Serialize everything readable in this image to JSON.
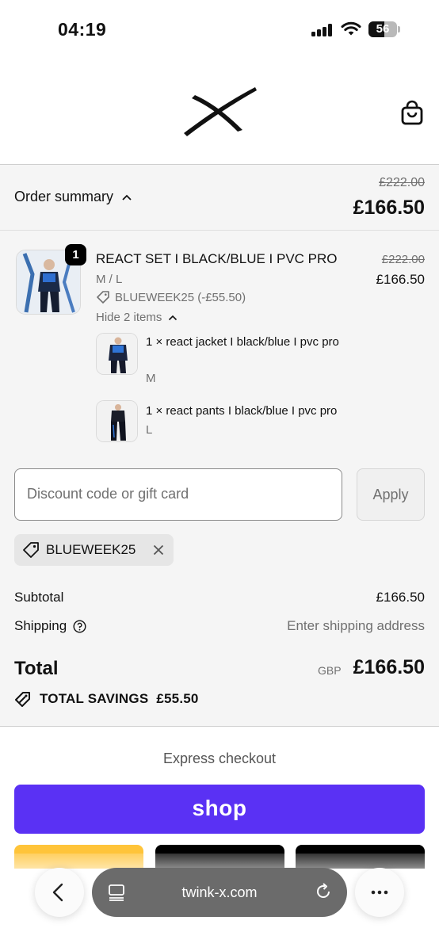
{
  "status_bar": {
    "time": "04:19",
    "battery": "56",
    "battery_level_percent": 56
  },
  "header": {
    "logo_icon": "x-logo",
    "cart_icon": "shopping-bag-icon"
  },
  "summary": {
    "toggle_label": "Order summary",
    "original_price": "£222.00",
    "price": "£166.50"
  },
  "product": {
    "quantity_badge": "1",
    "title": "REACT SET I BLACK/BLUE I PVC PRO",
    "variant": "M / L",
    "discount": "BLUEWEEK25 (-£55.50)",
    "original_price": "£222.00",
    "price": "£166.50",
    "hide_items_label": "Hide 2 items",
    "items": [
      {
        "name": "1 × react jacket I black/blue I pvc pro",
        "size": "M"
      },
      {
        "name": "1 × react pants I black/blue I pvc pro",
        "size": "L"
      }
    ]
  },
  "discount_form": {
    "placeholder": "Discount code or gift card",
    "apply_label": "Apply",
    "applied_code": "BLUEWEEK25"
  },
  "totals": {
    "subtotal_label": "Subtotal",
    "subtotal_value": "£166.50",
    "shipping_label": "Shipping",
    "shipping_value": "Enter shipping address",
    "total_label": "Total",
    "currency": "GBP",
    "total_value": "£166.50",
    "savings_label": "TOTAL SAVINGS",
    "savings_value": "£55.50"
  },
  "express": {
    "label": "Express checkout",
    "shop_label": "shop"
  },
  "browser": {
    "url": "twink-x.com"
  },
  "colors": {
    "shop_purple": "#5a31f4",
    "paypal_yellow": "#ffc439",
    "muted_text": "#707070"
  }
}
